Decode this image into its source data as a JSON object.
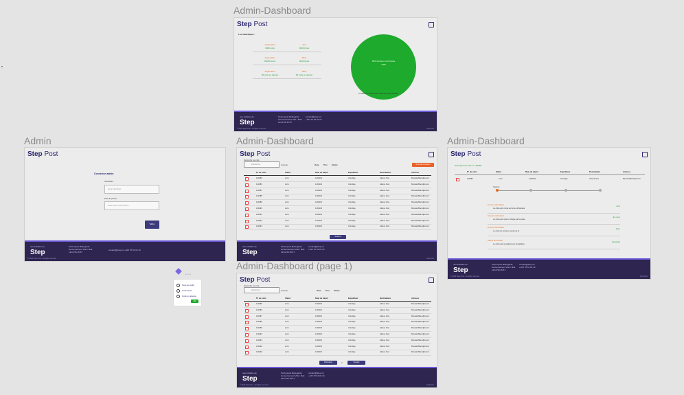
{
  "frames": {
    "top_dashboard": "Admin-Dashboard",
    "admin": "Admin",
    "mid_dashboard": "Admin-Dashboard",
    "right_dashboard": "Admin-Dashboard",
    "page1_dashboard": "Admin-Dashboard (page 1)"
  },
  "brand": {
    "step": "Step",
    "post": "Post"
  },
  "footer": {
    "tag": "une initiative de",
    "logo": "Step",
    "addr1": "Technopole Bellegarde",
    "addr2": "Gouvernement Ville / Mali",
    "addr3": "12/12 56 45 87",
    "mail": "contact@step.ml",
    "phone": "+223 76 54 32 10",
    "copyright": "© 2023 Step Post - All rights reserved",
    "right": "Step Post"
  },
  "stats": {
    "title": "Les statistiques :",
    "items": [
      {
        "label": "Aujourd'hui",
        "value": "0000 colis"
      },
      {
        "label": "Jour",
        "value": "0000 livrés"
      },
      {
        "label": "Aujourd'hui",
        "value": "00000 livrés"
      },
      {
        "label": "Mois",
        "value": "0000 livrés"
      },
      {
        "label": "Aujourd'hui",
        "value": "00 colis en attente"
      },
      {
        "label": "Mois",
        "value": "00 colis en attente"
      }
    ],
    "pie_label": "80% livraison confirmées",
    "pie_value": "1980",
    "pie_caption": "Livraisons confirmées affichées par période"
  },
  "login": {
    "title": "Connexion admin",
    "user_label": "Identifiant",
    "user_placeholder": "Entrez identifiant",
    "pass_label": "Mot de passe",
    "pass_placeholder": "Entrez votre mot de passe",
    "submit": "Valider"
  },
  "table": {
    "search_label": "Rechercher une colis",
    "search_placeholder": "Rechercher",
    "filter": "Annuler",
    "tabs": [
      "Date",
      "Prix",
      "Statut"
    ],
    "new_button": "Nouvelle Livraison",
    "headers": [
      "N° du colis",
      "Statut",
      "Date du dépôt",
      "Expéditeur",
      "Destinataire",
      "Adresse"
    ],
    "rows": [
      [
        "120485",
        "Livré",
        "12/09/22",
        "Ouindiga",
        "Adama Sow",
        "Bamako/Bacodjicoroni"
      ],
      [
        "120486",
        "Livré",
        "12/09/22",
        "Ouindiga",
        "Adama Sow",
        "Bamako/Bacodjicoroni"
      ],
      [
        "120487",
        "Livré",
        "12/09/22",
        "Ouindiga",
        "Adama Sow",
        "Bamako/Bacodjicoroni"
      ],
      [
        "120488",
        "Livré",
        "12/09/22",
        "Ouindiga",
        "Adama Sow",
        "Bamako/Bacodjicoroni"
      ],
      [
        "120489",
        "Livré",
        "12/09/22",
        "Ouindiga",
        "Adama Sow",
        "Bamako/Bacodjicoroni"
      ],
      [
        "120490",
        "Livré",
        "12/09/22",
        "Ouindiga",
        "Adama Sow",
        "Bamako/Bacodjicoroni"
      ],
      [
        "120491",
        "Livré",
        "12/09/22",
        "Ouindiga",
        "Adama Sow",
        "Bamako/Bacodjicoroni"
      ],
      [
        "120492",
        "Livré",
        "12/09/22",
        "Ouindiga",
        "Adama Sow",
        "Bamako/Bacodjicoroni"
      ],
      [
        "120493",
        "Livré",
        "12/09/22",
        "Ouindiga",
        "Adama Sow",
        "Bamako/Bacodjicoroni"
      ]
    ],
    "next": "Suivant",
    "prev": "Précédent",
    "page": "2"
  },
  "detail": {
    "title": "Historique du colis n° 120485",
    "headers": [
      "N° du colis",
      "Statut",
      "Date du dépôt",
      "Expéditeur",
      "Destinataire",
      "Adresse"
    ],
    "row": [
      "120485",
      "Livré",
      "12/09/22",
      "Ouindiga",
      "Adama Sow",
      "Bamako/Bacodjicoroni"
    ],
    "timeline_label": "Statuts",
    "history": [
      {
        "status": "En cours de livraison",
        "desc": "Le colis a été remis au livreur à Bamako",
        "result": "Livré"
      },
      {
        "status": "En cours de livraison",
        "desc": "Le colis a été pris en charge par la poste",
        "result": "En cours"
      },
      {
        "status": "En cours de livraison",
        "desc": "Le colis est arrivé au centre de tri",
        "result": "Reçu"
      },
      {
        "status": "Attente de livraison",
        "desc": "Le colis a été enregistré par l'expéditeur",
        "result": "Enregistré"
      }
    ]
  },
  "popup": {
    "items": [
      "Tous les colis",
      "Colis livrés",
      "Colis en attente"
    ],
    "button": "OK"
  }
}
